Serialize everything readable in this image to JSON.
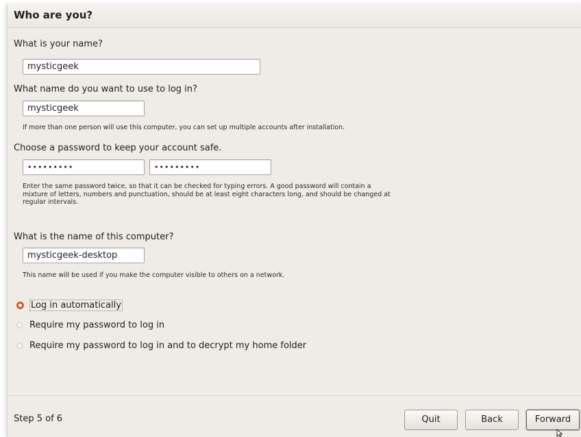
{
  "window": {
    "title": "Who are you?"
  },
  "form": {
    "name_label": "What is your name?",
    "name_value": "mysticgeek",
    "login_label": "What name do you want to use to log in?",
    "login_value": "mysticgeek",
    "login_hint": "If more than one person will use this computer, you can set up multiple accounts after installation.",
    "password_label": "Choose a password to keep your account safe.",
    "password_value": "•••••••••",
    "password_confirm_value": "•••••••••",
    "password_hint": [
      "Enter the same password twice, so that it can be checked for typing errors. A good password will contain a",
      "mixture of letters, numbers and punctuation, should be at least eight characters long, and should be changed at",
      "regular intervals."
    ],
    "computer_label": "What is the name of this computer?",
    "computer_value": "mysticgeek-desktop",
    "computer_hint": "This name will be used if you make the computer visible to others on a network."
  },
  "login_options": [
    {
      "label": "Log in automatically",
      "checked": true
    },
    {
      "label": "Require my password to log in",
      "checked": false
    },
    {
      "label": "Require my password to log in and to decrypt my home folder",
      "checked": false
    }
  ],
  "footer": {
    "step": "Step 5 of 6",
    "quit": "Quit",
    "back": "Back",
    "forward": "Forward"
  },
  "colors": {
    "accent": "#d9541e",
    "background": "#efebe7"
  }
}
